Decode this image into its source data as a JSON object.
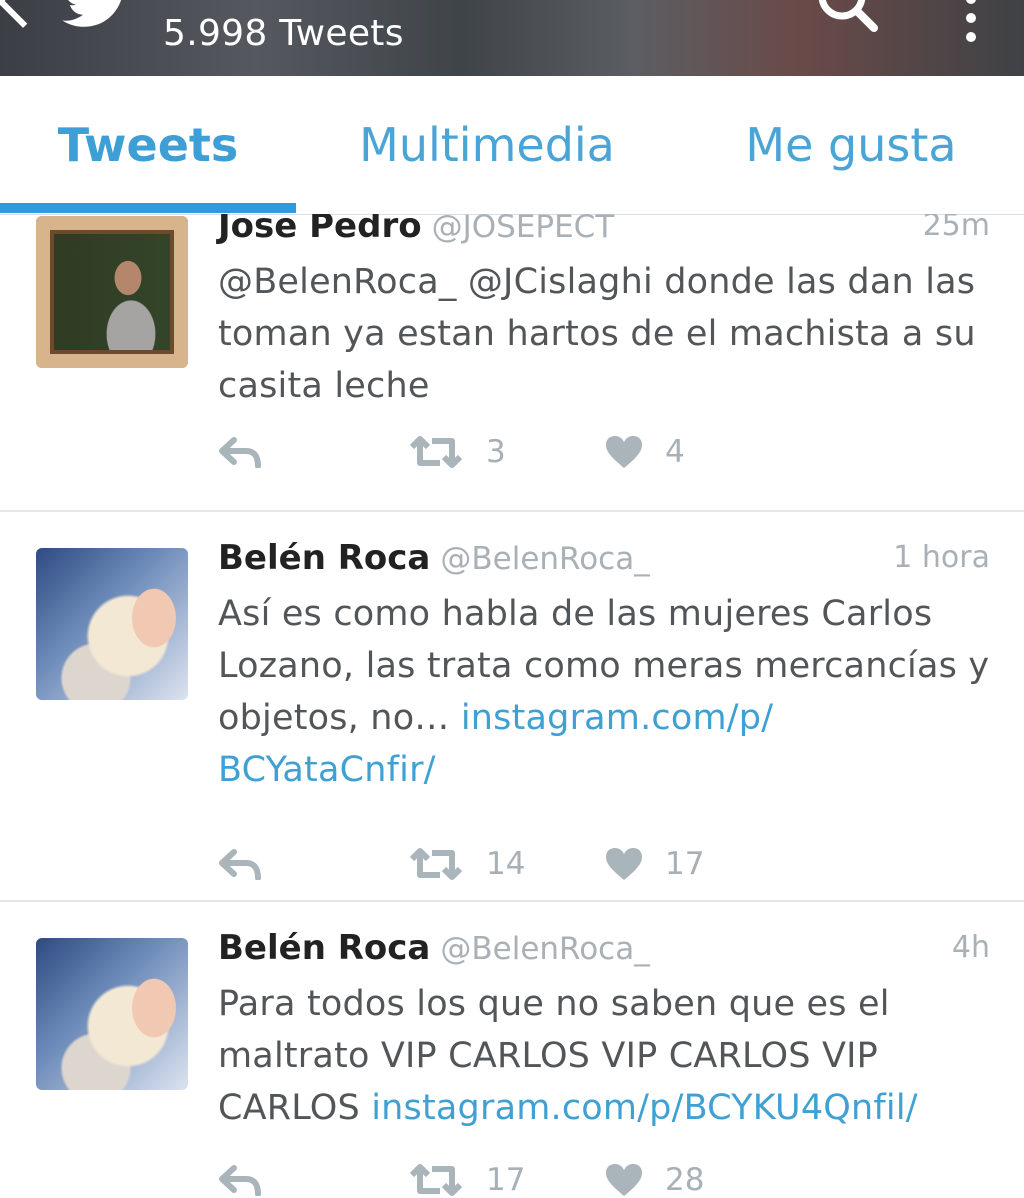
{
  "header": {
    "tweet_count": "5.998 Tweets",
    "back_icon": "back-arrow-icon",
    "bird_icon": "twitter-bird-icon",
    "search_icon": "search-icon",
    "more_icon": "more-vertical-icon"
  },
  "tabs": [
    {
      "label": "Tweets",
      "active": true
    },
    {
      "label": "Multimedia",
      "active": false
    },
    {
      "label": "Me gusta",
      "active": false
    }
  ],
  "colors": {
    "accent": "#2f9bde",
    "link": "#3fa1d3",
    "muted": "#a9b1b7"
  },
  "tweets": [
    {
      "name": "Jose Pedro",
      "handle": "@JOSEPECT",
      "time": "25m",
      "text_parts": [
        "@BelenRoca_ @JCislaghi donde las dan las toman ya estan hartos de el machista a su casita leche"
      ],
      "retweets": "3",
      "likes": "4"
    },
    {
      "name": "Belén Roca",
      "handle": "@BelenRoca_",
      "time": "1 hora",
      "text_parts": [
        "Así es como habla de las mujeres Carlos Lozano, las trata como meras mercancías y objetos, no… ",
        "instagram.com/p/ BCYataCnfir/"
      ],
      "retweets": "14",
      "likes": "17"
    },
    {
      "name": "Belén Roca",
      "handle": "@BelenRoca_",
      "time": "4h",
      "text_parts": [
        "Para todos los que no saben que es el maltrato VIP CARLOS  VIP CARLOS VIP CARLOS ",
        "instagram.com/p/BCYKU4Qnfil/"
      ],
      "retweets": "17",
      "likes": "28"
    }
  ]
}
